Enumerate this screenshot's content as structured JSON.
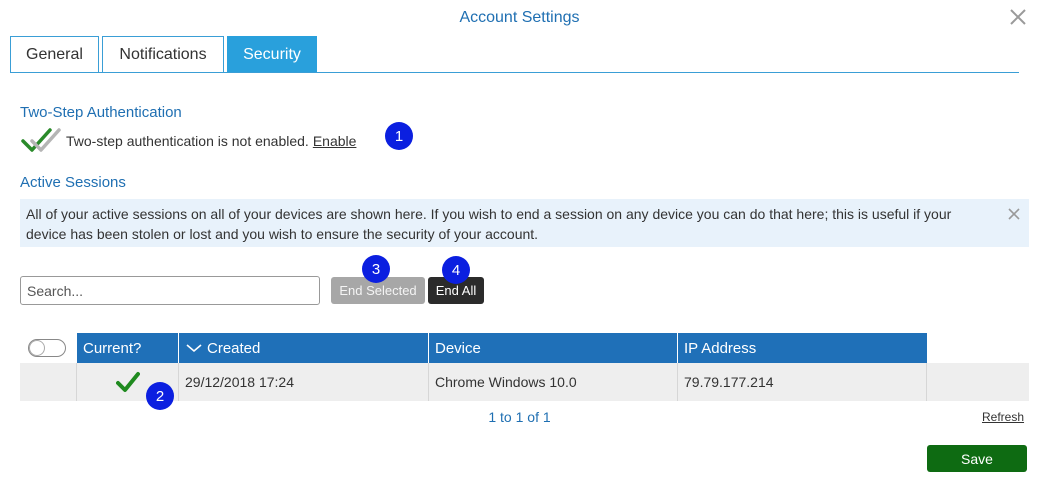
{
  "dialog": {
    "title": "Account Settings"
  },
  "tabs": [
    {
      "label": "General",
      "active": false
    },
    {
      "label": "Notifications",
      "active": false
    },
    {
      "label": "Security",
      "active": true
    }
  ],
  "two_step": {
    "heading": "Two-Step Authentication",
    "status_text": "Two-step authentication is not enabled.",
    "enable_link": "Enable",
    "icon": "double-check-icon"
  },
  "active_sessions": {
    "heading": "Active Sessions",
    "info": "All of your active sessions on all of your devices are shown here. If you wish to end a session on any device you can do that here; this is useful if your device has been stolen or lost and you wish to ensure the security of your account."
  },
  "toolbar": {
    "search_placeholder": "Search...",
    "end_selected": "End Selected",
    "end_all": "End All"
  },
  "table": {
    "columns": [
      "Current?",
      "Created",
      "Device",
      "IP Address"
    ],
    "rows": [
      {
        "current": true,
        "created": "29/12/2018 17:24",
        "device": "Chrome Windows 10.0",
        "ip": "79.79.177.214"
      }
    ]
  },
  "pagination": {
    "text": "1 to 1 of 1",
    "refresh": "Refresh"
  },
  "footer": {
    "save": "Save"
  },
  "annotations": [
    "1",
    "2",
    "3",
    "4"
  ],
  "colors": {
    "accent": "#1f70b8",
    "tab_active": "#29a0dc",
    "save": "#0e6b12",
    "badge": "#0b1fe0",
    "check": "#1f8a1f"
  }
}
